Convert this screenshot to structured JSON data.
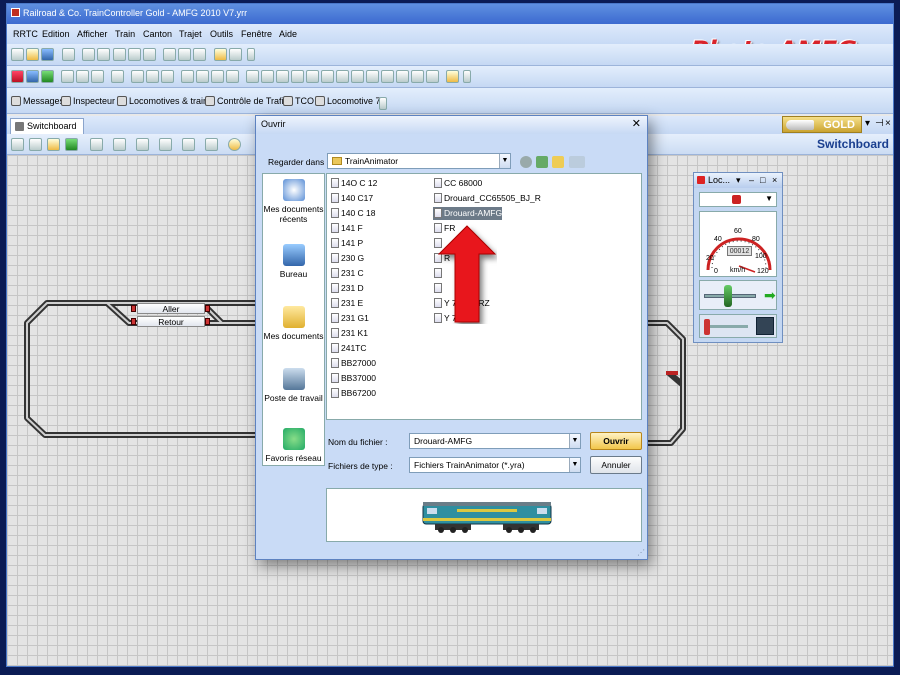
{
  "window": {
    "title": "Railroad & Co. TrainController Gold - AMFG 2010 V7.yrr"
  },
  "menu": [
    "RRTC",
    "Edition",
    "Afficher",
    "Train",
    "Canton",
    "Trajet",
    "Outils",
    "Fenêtre",
    "Aide"
  ],
  "logo": {
    "text": "Photo AMFG",
    "color": "#d8232a"
  },
  "toolbar3": {
    "items": [
      "Messages",
      "Inspecteur",
      "Locomotives & trains",
      "Contrôle de Trafic",
      "TCO",
      "Locomotive 7"
    ]
  },
  "tab": {
    "label": "Switchboard"
  },
  "gold": {
    "label": "GOLD"
  },
  "switchboard": {
    "title": "Switchboard"
  },
  "track_buttons": {
    "aller": "Aller",
    "retour": "Retour"
  },
  "loco_panel": {
    "title": "Loc...",
    "readout": "00012",
    "unit": "km/h",
    "scale": [
      "20",
      "40",
      "60",
      "80",
      "100",
      "120",
      "0"
    ]
  },
  "dialog": {
    "title": "Ouvrir",
    "look_in_label": "Regarder dans :",
    "look_in_value": "TrainAnimator",
    "places": [
      "Mes documents récents",
      "Bureau",
      "Mes documents",
      "Poste de travail",
      "Favoris réseau"
    ],
    "files_col1": [
      "14O C 12",
      "140 C17",
      "140 C 18",
      "141 F",
      "141 P",
      "230 G",
      "231 C",
      "231 D",
      "231 E",
      "231 G1",
      "231 K1",
      "241TC",
      "BB27000",
      "BB37000",
      "BB67200"
    ],
    "files_col2": [
      "CC 68000",
      "Drouard_CC65505_BJ_R",
      "Drouard-AMFG",
      "FR",
      "",
      "R",
      "",
      "",
      "Y 7100 ARZ",
      "Y 7100 V"
    ],
    "selected_file": "Drouard-AMFG",
    "filename_label": "Nom du fichier :",
    "filename_value": "Drouard-AMFG",
    "filetype_label": "Fichiers de type :",
    "filetype_value": "Fichiers TrainAnimator (*.yra)",
    "open_button": "Ouvrir",
    "cancel_button": "Annuler"
  },
  "colors": {
    "accent": "#3c6ad0",
    "arrow": "#e8141c",
    "gold": "#c9a330"
  }
}
